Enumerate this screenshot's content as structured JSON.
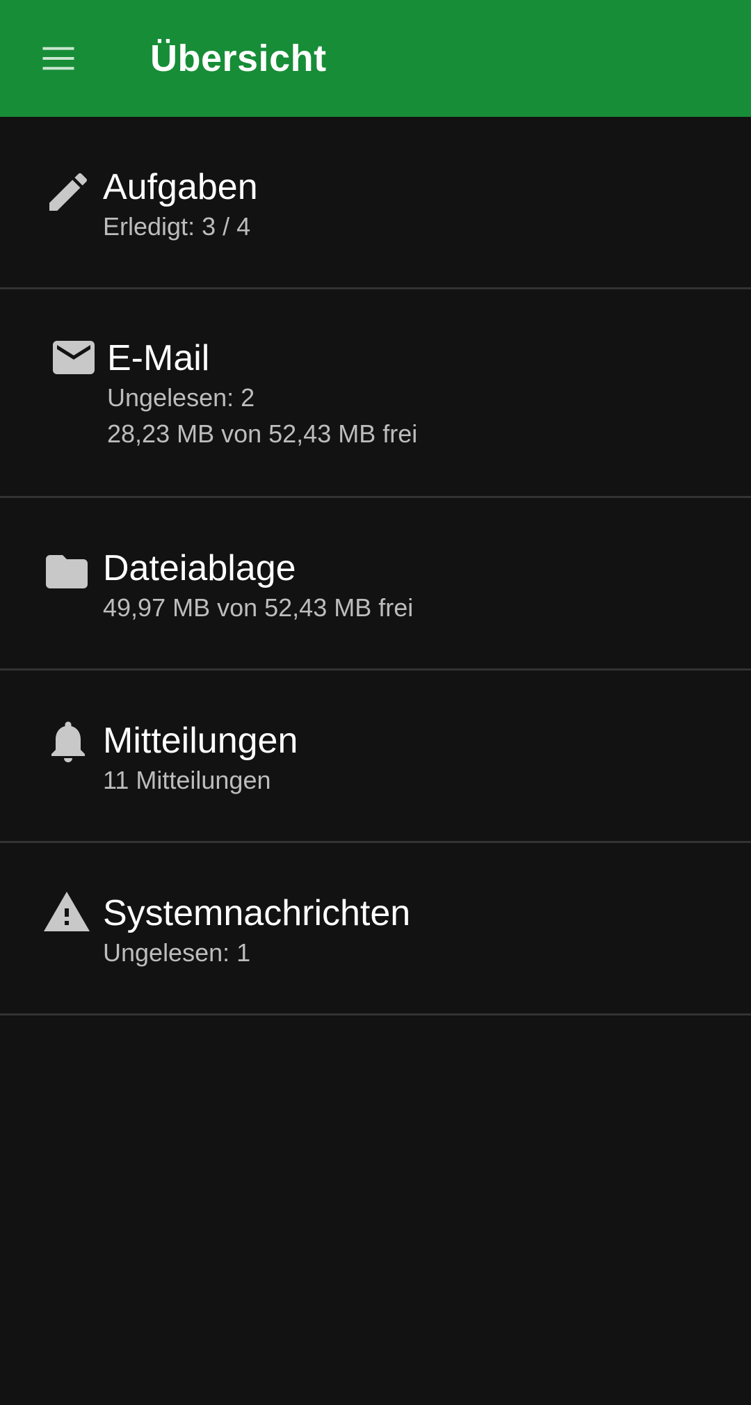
{
  "appbar": {
    "title": "Übersicht",
    "menu_icon": "menu-icon",
    "background": "#178d37"
  },
  "items": [
    {
      "icon": "pencil-icon",
      "title": "Aufgaben",
      "lines": [
        "Erledigt: 3 / 4"
      ]
    },
    {
      "icon": "mail-icon",
      "title": "E-Mail",
      "lines": [
        "Ungelesen: 2",
        "28,23 MB von 52,43 MB frei"
      ]
    },
    {
      "icon": "folder-icon",
      "title": "Dateiablage",
      "lines": [
        "49,97 MB von 52,43 MB frei"
      ]
    },
    {
      "icon": "bell-icon",
      "title": "Mitteilungen",
      "lines": [
        "11 Mitteilungen"
      ]
    },
    {
      "icon": "warning-icon",
      "title": "Systemnachrichten",
      "lines": [
        "Ungelesen: 1"
      ]
    }
  ],
  "colors": {
    "background": "#121212",
    "divider": "#333333",
    "title_text": "#ffffff",
    "sub_text": "#bdbdbd",
    "icon": "#c8c8c8"
  }
}
